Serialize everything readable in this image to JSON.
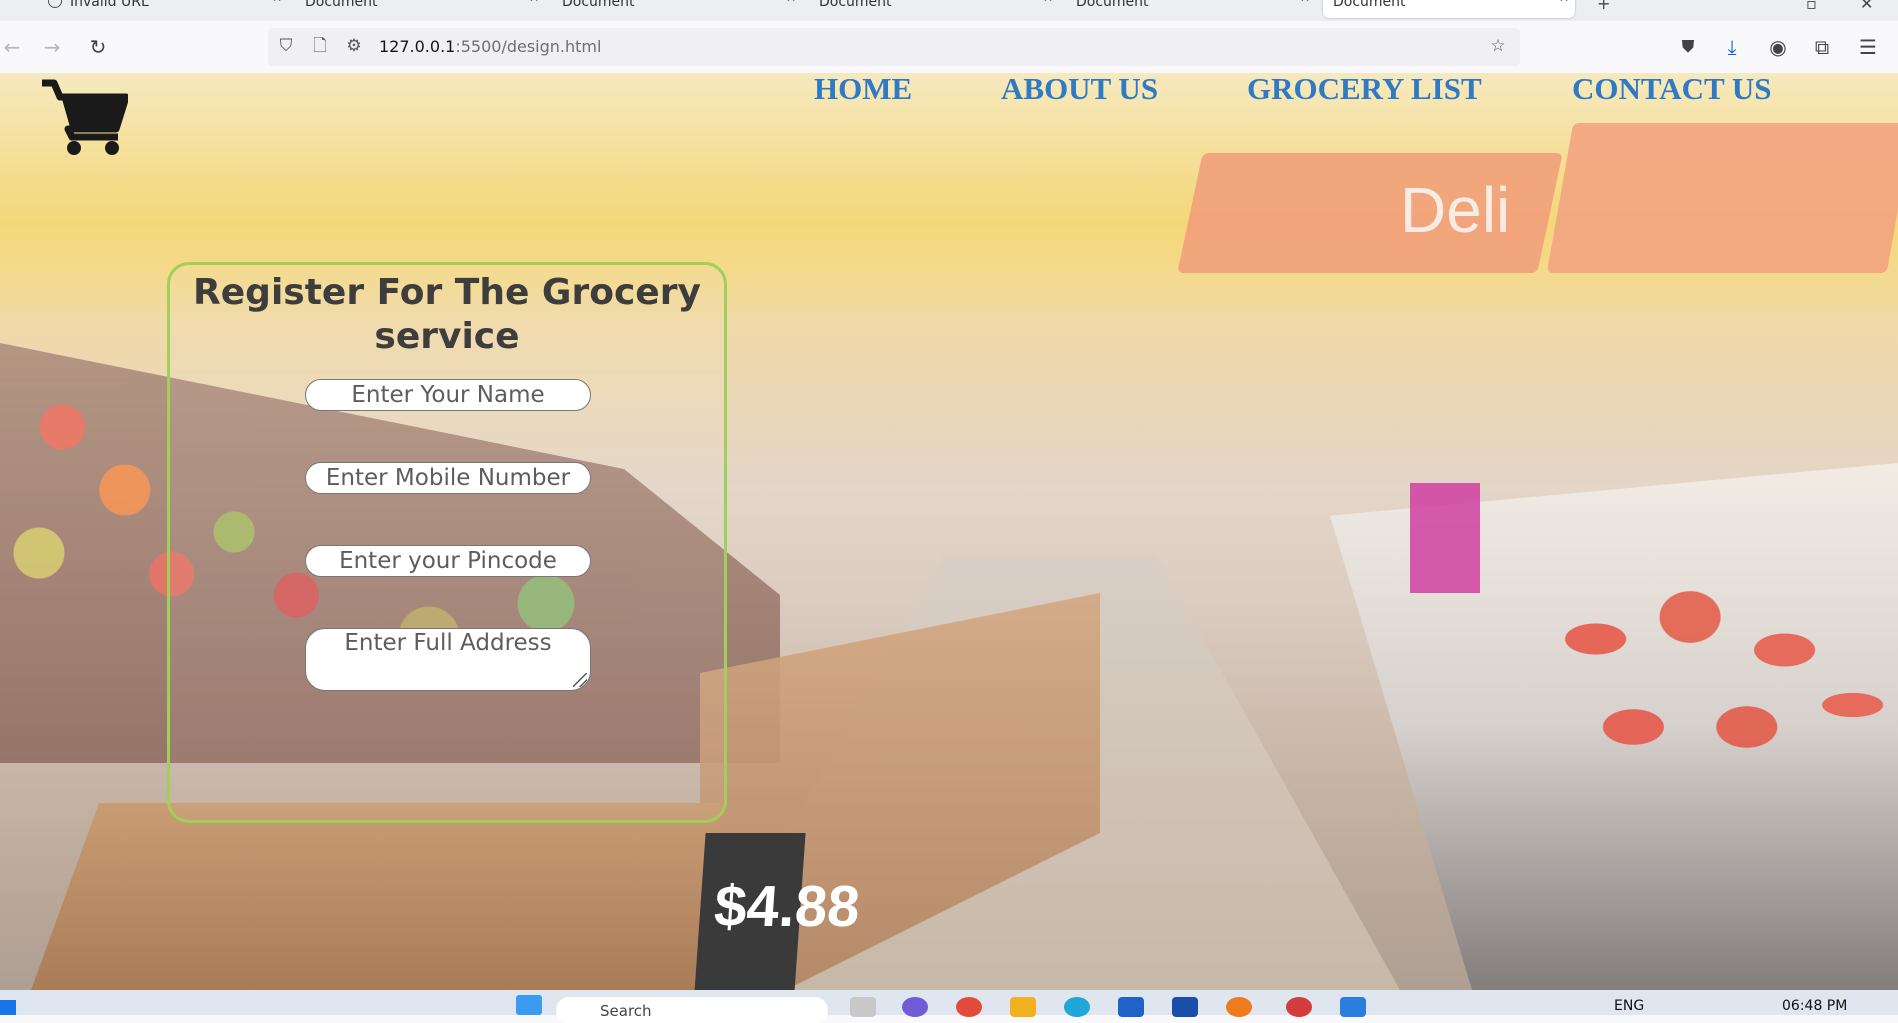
{
  "browser": {
    "tabs": [
      {
        "label": "Invalid URL"
      },
      {
        "label": "Document"
      },
      {
        "label": "Document"
      },
      {
        "label": "Document"
      },
      {
        "label": "Document"
      },
      {
        "label": "Document"
      }
    ],
    "url_host": "127.0.0.1",
    "url_rest": ":5500/design.html"
  },
  "site": {
    "nav": [
      "HOME",
      "ABOUT US",
      "GROCERY LIST",
      "CONTACT US"
    ],
    "nav_color": "#2f79c5",
    "form": {
      "title": "Register For The Grocery service",
      "name_placeholder": "Enter Your Name",
      "mobile_placeholder": "Enter Mobile Number",
      "pincode_placeholder": "Enter your Pincode",
      "address_placeholder": "Enter Full Address",
      "border_color": "#9ed05a"
    },
    "background_text": {
      "deli": "Deli",
      "price": "$4.88"
    }
  },
  "taskbar": {
    "search_label": "Search",
    "language": "ENG",
    "time": "06:48 PM"
  }
}
